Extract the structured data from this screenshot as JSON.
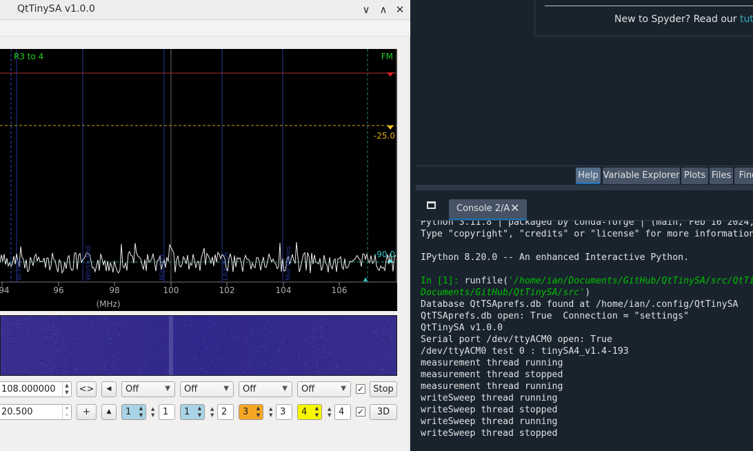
{
  "qt": {
    "title": "QtTinySA v1.0.0",
    "window_buttons": [
      "∨",
      "∧",
      "✕"
    ],
    "spectrum": {
      "left_label": "R3 to 4",
      "right_label": "FM",
      "ref_level_1": "-25.0",
      "ref_level_2": "-90.0",
      "x_ticks": [
        "94",
        "96",
        "98",
        "100",
        "102",
        "104",
        "106"
      ],
      "x_unit": "(MHz)",
      "freq_markers": [
        "W-Mid",
        "Worth Mid",
        "Mid 101",
        "LAX FLA",
        "Mid Wales"
      ]
    },
    "controls": {
      "stop_freq": "108.000000",
      "span": "20.500",
      "swap_btn": "<>",
      "plus_btn": "+",
      "left_btn": "◀",
      "up_btn": "▲",
      "trace_combos": [
        "Off",
        "Off",
        "Off",
        "Off"
      ],
      "trace_check_1": "✓",
      "stop_btn": "Stop",
      "markers": [
        "1",
        "1",
        "1",
        "2",
        "3",
        "3",
        "4",
        "4"
      ],
      "trace_check_2": "✓",
      "btn_3d": "3D"
    }
  },
  "spyder": {
    "help_text": "New to Spyder? Read our ",
    "help_link": "tutorial",
    "pane_tabs": [
      "Help",
      "Variable Explorer",
      "Plots",
      "Files",
      "Find"
    ],
    "console_tab": "Console 2/A",
    "console_lines": [
      "Python 3.11.8 | packaged by conda-forge | (main, Feb 16 2024,",
      "Type \"copyright\", \"credits\" or \"license\" for more information.",
      "",
      "IPython 8.20.0 -- An enhanced Interactive Python.",
      "",
      "",
      "",
      "Database QtTSAprefs.db found at /home/ian/.config/QtTinySA",
      "QtTSAprefs.db open: True  Connection = \"settings\"",
      "QtTinySA v1.0.0",
      "Serial port /dev/ttyACM0 open: True",
      "/dev/ttyACM0 test 0 : tinySA4_v1.4-193",
      "measurement thread running",
      "measurement thread stopped",
      "measurement thread running",
      "writeSweep thread running",
      "writeSweep thread stopped",
      "writeSweep thread running",
      "writeSweep thread stopped"
    ],
    "prompt_label": "In [1]: ",
    "prompt_cmd": "runfile(",
    "prompt_arg1": "'/home/ian/Documents/GitHub/QtTinySA/src/QtTin",
    "prompt_arg2": "Documents/GitHub/QtTinySA/src'",
    "prompt_tail": ")"
  }
}
